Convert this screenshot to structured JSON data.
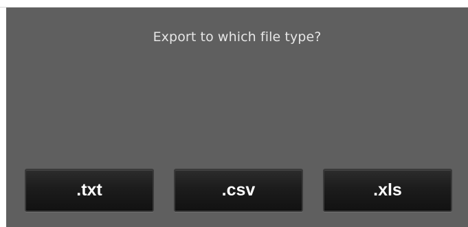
{
  "dialog": {
    "prompt": "Export to which file type?",
    "buttons": [
      {
        "label": ".txt"
      },
      {
        "label": ".csv"
      },
      {
        "label": ".xls"
      }
    ]
  },
  "colors": {
    "dialog_background": "#5f5f5f",
    "prompt_text": "#e6e6e6",
    "button_background": "#1c1c1c",
    "button_text": "#ffffff"
  }
}
